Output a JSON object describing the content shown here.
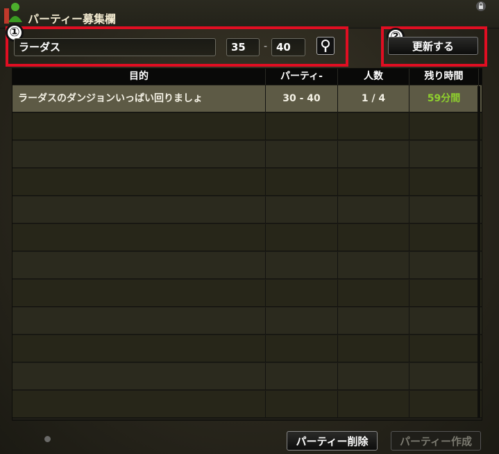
{
  "window": {
    "title": "パーティー募集欄"
  },
  "annotations": {
    "one": "①",
    "two": "②"
  },
  "search": {
    "keyword": "ラーダス",
    "level_min": "35",
    "level_sep": "-",
    "level_max": "40"
  },
  "refresh_label": "更新する",
  "table": {
    "headers": [
      "目的",
      "パーティ-",
      "人数",
      "残り時間"
    ],
    "rows": [
      {
        "purpose": "ラーダスのダンジョンいっぱい回りましょ",
        "level": "30 - 40",
        "members": "1 / 4",
        "time": "59分間"
      }
    ],
    "time_color": "#8fd02e"
  },
  "footer": {
    "delete_label": "パーティー削除",
    "create_label": "パーティー作成"
  },
  "icons": {
    "search": "magnifier-icon",
    "lock": "lock-icon",
    "character": "character-icon"
  }
}
